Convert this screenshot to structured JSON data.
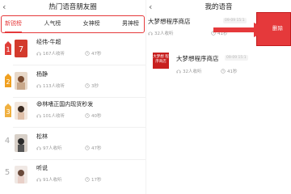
{
  "left": {
    "title": "热门语音朋友圈",
    "back_icon": "chevron-left-icon",
    "tabs": [
      "新锐榜",
      "人气榜",
      "女神榜",
      "男神榜"
    ],
    "active_tab": "新锐榜",
    "rows": [
      {
        "rank": "1",
        "name": "经伟-牛超",
        "listens": "167人收听",
        "duration": "47秒"
      },
      {
        "rank": "2",
        "name": "杨静",
        "listens": "113人收听",
        "duration": "3秒"
      },
      {
        "rank": "3",
        "name": "😄林嗜正国内现货秒发",
        "listens": "101人收听",
        "duration": "40秒"
      },
      {
        "rank": "4",
        "name": "松林",
        "listens": "97人收听",
        "duration": "47秒"
      },
      {
        "rank": "5",
        "name": "听说",
        "listens": "91人收听",
        "duration": "17秒"
      }
    ]
  },
  "right": {
    "title": "我的语音",
    "back_icon": "chevron-left-icon",
    "items": [
      {
        "name": "大梦想程序商店",
        "tag": "09-09 15:1",
        "listens": "32人收听",
        "duration": "41秒"
      },
      {
        "name": "大梦想程序商店",
        "tag": "09-09 15:1",
        "listens": "32人收听",
        "duration": "41秒",
        "logo_text": "大梦想 程序商店"
      }
    ],
    "delete_label": "删除"
  },
  "colors": {
    "accent": "#e5393b"
  }
}
